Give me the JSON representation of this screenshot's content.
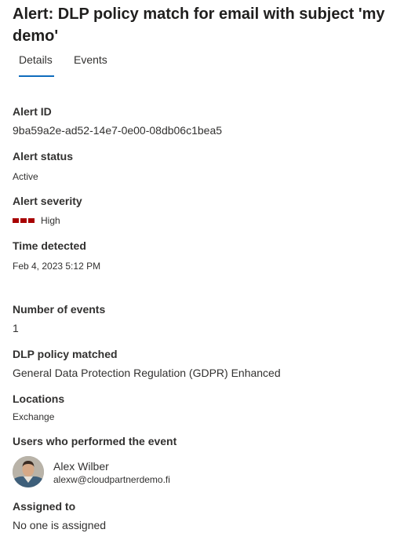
{
  "header": {
    "title": "Alert: DLP policy match for email with subject 'my demo'"
  },
  "tabs": [
    {
      "label": "Details",
      "selected": true
    },
    {
      "label": "Events",
      "selected": false
    }
  ],
  "details": {
    "alert_id": {
      "label": "Alert ID",
      "value": "9ba59a2e-ad52-14e7-0e00-08db06c1bea5"
    },
    "alert_status": {
      "label": "Alert status",
      "value": "Active"
    },
    "alert_severity": {
      "label": "Alert severity",
      "value": "High",
      "bars": 3,
      "color": "#a80000"
    },
    "time_detected": {
      "label": "Time detected",
      "value": "Feb 4, 2023 5:12 PM"
    },
    "number_of_events": {
      "label": "Number of events",
      "value": "1"
    },
    "dlp_policy": {
      "label": "DLP policy matched",
      "value": "General Data Protection Regulation (GDPR) Enhanced"
    },
    "locations": {
      "label": "Locations",
      "value": "Exchange"
    },
    "users": {
      "label": "Users who performed the event",
      "user": {
        "name": "Alex Wilber",
        "email": "alexw@cloudpartnerdemo.fi",
        "avatar_icon": "user-photo-icon"
      }
    },
    "assigned_to": {
      "label": "Assigned to",
      "value": "No one is assigned"
    }
  },
  "colors": {
    "accent": "#0f6cbd",
    "severity_high": "#a80000"
  }
}
